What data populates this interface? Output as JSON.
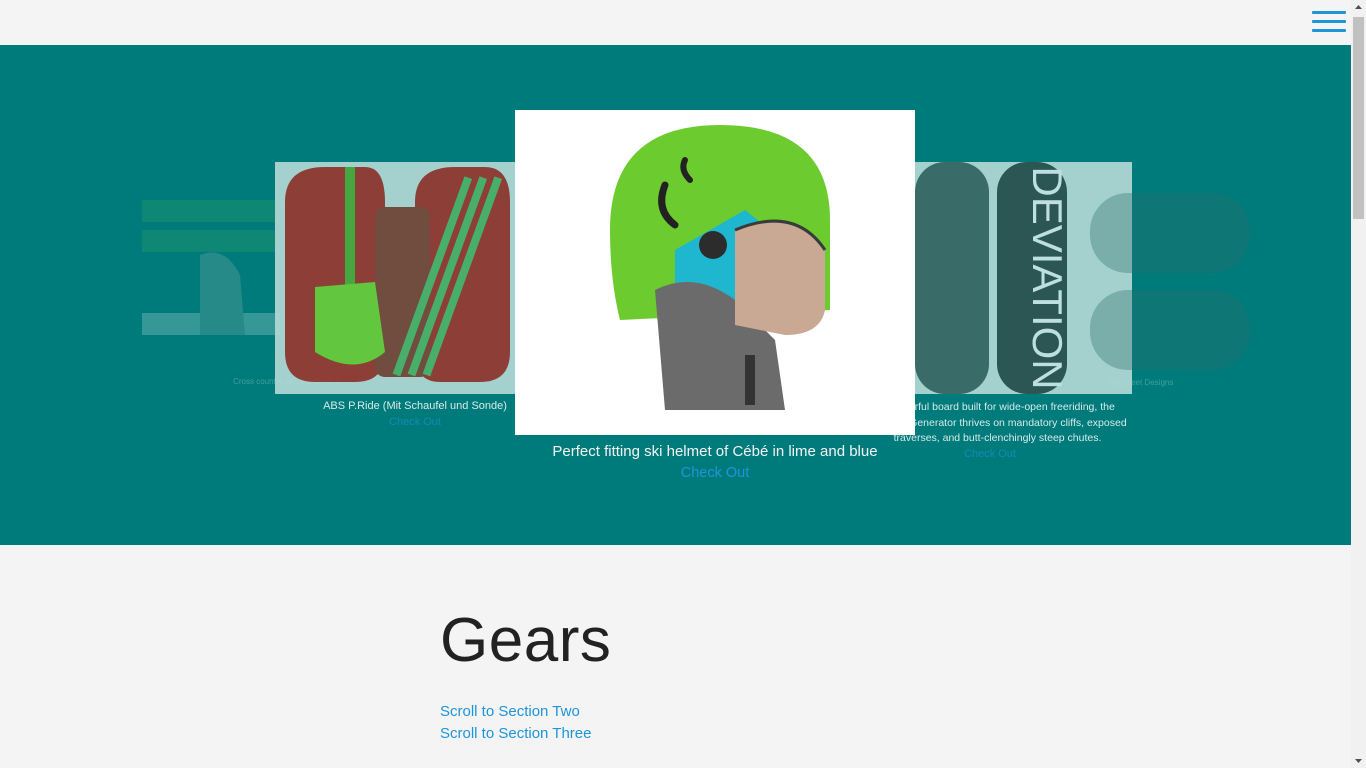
{
  "nav": {
    "menu_icon": "hamburger-menu-icon"
  },
  "carousel": {
    "slides": [
      {
        "caption": "Cross country set: ski, boots a..."
      },
      {
        "caption": "ABS P.Ride (Mit Schaufel und Sonde)",
        "link": "Check Out"
      },
      {
        "caption": "Perfect fitting ski helmet of Cébé in lime and blue",
        "link": "Check Out"
      },
      {
        "caption": "A powerful board built for wide-open freeriding, the Moment Generator thrives on mandatory cliffs, exposed traverses, and butt-clenchingly steep chutes.",
        "link": "Check Out"
      },
      {
        "caption": "Tall Street Designs"
      }
    ],
    "board_text": "DEVIATION"
  },
  "section": {
    "title": "Gears",
    "links": [
      "Scroll to Section Two",
      "Scroll to Section Three"
    ]
  },
  "colors": {
    "band": "#007b7b",
    "accent": "#1e95d8",
    "helmet": "#6ccb2e",
    "helmet_blue": "#1fb6d0"
  }
}
